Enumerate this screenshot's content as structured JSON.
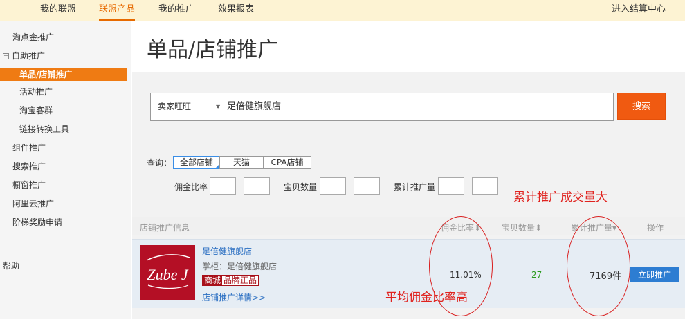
{
  "topnav": {
    "items": [
      "我的联盟",
      "联盟产品",
      "我的推广",
      "效果报表"
    ],
    "active_index": 1,
    "settlement_link": "进入结算中心"
  },
  "sidebar": {
    "items": [
      {
        "label": "淘点金推广"
      },
      {
        "label": "自助推广",
        "collapse": "−"
      },
      {
        "label": "单品/店铺推广",
        "active": true
      },
      {
        "label": "活动推广"
      },
      {
        "label": "淘宝客群"
      },
      {
        "label": "链接转换工具"
      },
      {
        "label": "组件推广"
      },
      {
        "label": "搜索推广"
      },
      {
        "label": "橱窗推广"
      },
      {
        "label": "阿里云推广"
      },
      {
        "label": "阶梯奖励申请"
      }
    ],
    "help_label": "帮助"
  },
  "page": {
    "title": "单品/店铺推广"
  },
  "search": {
    "type_label": "卖家旺旺",
    "type_arrow": "▼",
    "query_value": "足倍健旗舰店",
    "button_label": "搜索"
  },
  "filters": {
    "label": "查询：",
    "tabs": [
      "全部店铺",
      "天猫",
      "CPA店铺"
    ],
    "active_tab": 0,
    "ranges": [
      {
        "label": "佣金比率"
      },
      {
        "label": "宝贝数量"
      },
      {
        "label": "累计推广量"
      }
    ],
    "dash": "-"
  },
  "annotations": {
    "volume": "累计推广成交量大",
    "commission": "平均佣金比率高"
  },
  "table": {
    "headers": {
      "info": "店铺推广信息",
      "commission": "佣金比率",
      "items": "宝贝数量",
      "volume": "累计推广量",
      "action": "操作"
    },
    "sort_both": "⬍",
    "sort_down": "▾",
    "rows": [
      {
        "logo_text": "Zube J",
        "shop_name": "足倍健旗舰店",
        "owner": "掌柜：足倍健旗舰店",
        "mall_badge": "商城",
        "genuine_badge": "品牌正品",
        "detail_link": "店铺推广详情>>",
        "commission": "11.01%",
        "item_count": "27",
        "volume": "7169件",
        "action_label": "立即推广"
      }
    ]
  },
  "colors": {
    "accent_orange": "#e76a00",
    "search_button": "#f05a11",
    "link_blue": "#2b6fc2",
    "annotation_red": "#e0231f",
    "item_count_green": "#2a9a1c",
    "promote_button": "#2d7dd2"
  }
}
